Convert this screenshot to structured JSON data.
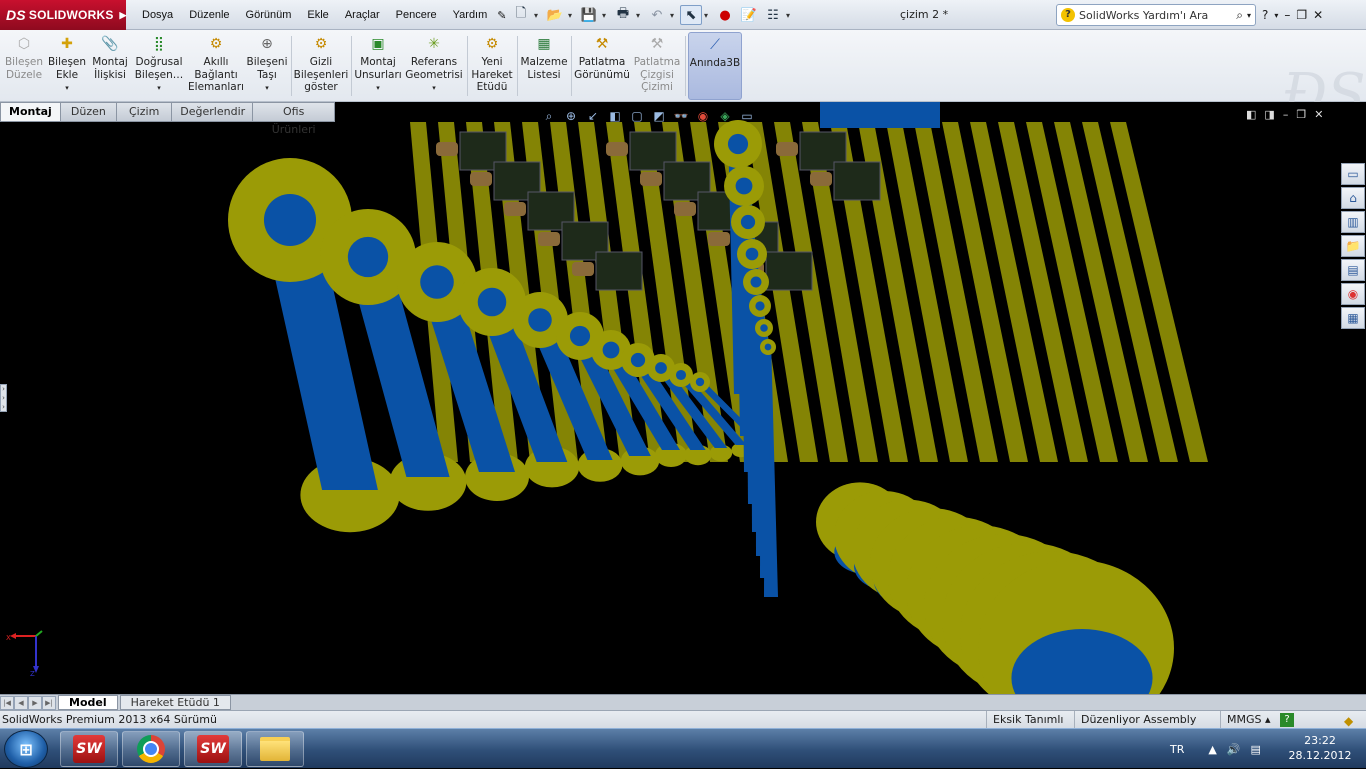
{
  "app": {
    "logo_text": "SOLIDWORKS",
    "document_title": "çizim 2 *"
  },
  "menu": [
    "Dosya",
    "Düzenle",
    "Görünüm",
    "Ekle",
    "Araçlar",
    "Pencere",
    "Yardım"
  ],
  "help_search": {
    "placeholder": "SolidWorks Yardım'ı Ara"
  },
  "ribbon": {
    "buttons": [
      {
        "label1": "Bileşen",
        "label2": "Düzele",
        "label3": "",
        "icon": "component-edit-icon",
        "enabled": false
      },
      {
        "label1": "Bileşen",
        "label2": "Ekle",
        "label3": "",
        "icon": "insert-component-icon",
        "enabled": true
      },
      {
        "label1": "Montaj",
        "label2": "İlişkisi",
        "label3": "",
        "icon": "mate-icon",
        "enabled": true
      },
      {
        "label1": "Doğrusal",
        "label2": "Bileşen…",
        "label3": "",
        "icon": "linear-pattern-icon",
        "enabled": true
      },
      {
        "label1": "Akıllı",
        "label2": "Bağlantı",
        "label3": "Elemanları",
        "icon": "smart-fasteners-icon",
        "enabled": true
      },
      {
        "label1": "Bileşeni",
        "label2": "Taşı",
        "label3": "",
        "icon": "move-component-icon",
        "enabled": true
      },
      {
        "label1": "Gizli",
        "label2": "Bileşenleri",
        "label3": "göster",
        "icon": "show-hidden-icon",
        "enabled": true
      },
      {
        "label1": "Montaj",
        "label2": "Unsurları",
        "label3": "",
        "icon": "assembly-features-icon",
        "enabled": true
      },
      {
        "label1": "Referans",
        "label2": "Geometrisi",
        "label3": "",
        "icon": "reference-geometry-icon",
        "enabled": true
      },
      {
        "label1": "Yeni",
        "label2": "Hareket",
        "label3": "Etüdü",
        "icon": "motion-study-icon",
        "enabled": true
      },
      {
        "label1": "Malzeme",
        "label2": "Listesi",
        "label3": "",
        "icon": "bom-icon",
        "enabled": true
      },
      {
        "label1": "Patlatma",
        "label2": "Görünümü",
        "label3": "",
        "icon": "exploded-view-icon",
        "enabled": true
      },
      {
        "label1": "Patlatma",
        "label2": "Çizgisi",
        "label3": "Çizimi",
        "icon": "explode-line-icon",
        "enabled": false
      },
      {
        "label1": "Anında3B",
        "label2": "",
        "label3": "",
        "icon": "instant3d-icon",
        "enabled": true
      }
    ]
  },
  "command_tabs": [
    "Montaj",
    "Düzen",
    "Çizim",
    "Değerlendir",
    "Ofis Ürünleri"
  ],
  "model_tabs": [
    "Model",
    "Hareket Etüdü 1"
  ],
  "status": {
    "left": "SolidWorks Premium 2013 x64 Sürümü",
    "item1": "Eksik Tanımlı",
    "item2": "Düzenliyor Assembly",
    "units": "MMGS"
  },
  "tray": {
    "language": "TR",
    "time": "23:22",
    "date": "28.12.2012"
  },
  "colors": {
    "part_yellow": "#9b9b06",
    "part_blue": "#0a52a6",
    "brand_red": "#c8102e"
  }
}
